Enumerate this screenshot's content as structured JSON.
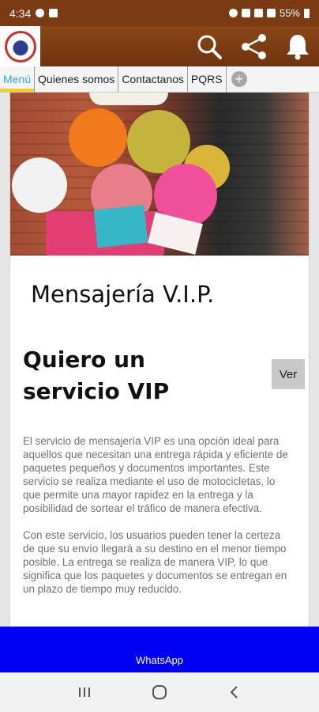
{
  "status_bar": {
    "time": "4:34",
    "battery": "55%"
  },
  "app_bar": {
    "logo_icon": "company-logo",
    "actions": [
      "search-icon",
      "share-icon",
      "bell-icon"
    ]
  },
  "tabs": [
    {
      "label": "Menú",
      "active": true
    },
    {
      "label": "Quienes somos",
      "active": false
    },
    {
      "label": "Contactanos",
      "active": false
    },
    {
      "label": "PQRS",
      "active": false
    }
  ],
  "card": {
    "title": "Mensajería V.I.P.",
    "service_title": "Quiero un servicio VIP",
    "button_label": "Ver",
    "paragraphs": [
      "El servicio de mensajería VIP es una opción ideal para aquellos que necesitan una entrega rápida y eficiente de paquetes pequeños y documentos importantes. Este servicio se realiza mediante el uso de motocicletas, lo que permite una mayor rapidez en la entrega y la posibilidad de sortear el tráfico de manera efectiva.",
      "Con este servicio, los usuarios pueden tener la certeza de que su envío llegará a su destino en el menor tiempo posible. La entrega se realiza de manera VIP, lo que significa que los paquetes y documentos se entregan en un plazo de tiempo muy reducido."
    ]
  },
  "whatsapp": {
    "label": "WhatsApp"
  },
  "colors": {
    "status_bar": "#7a3a14",
    "app_bar": "#8b4618",
    "active_tab_text": "#2aa6d8",
    "active_tab_indicator": "#f0d020",
    "whatsapp_bar": "#0000f5"
  }
}
